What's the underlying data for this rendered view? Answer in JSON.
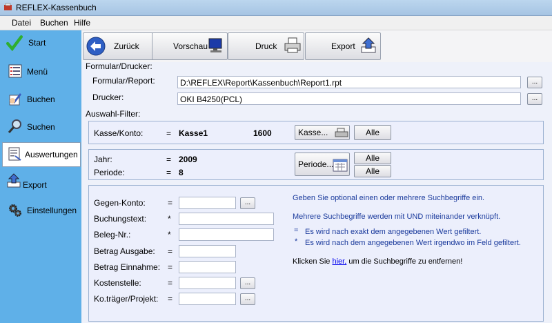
{
  "window": {
    "title": "REFLEX-Kassenbuch"
  },
  "menu": [
    "Datei",
    "Buchen",
    "Hilfe"
  ],
  "sidebar": {
    "items": [
      {
        "label": "Start",
        "icon": "checkmark-icon"
      },
      {
        "label": "Menü",
        "icon": "list-icon"
      },
      {
        "label": "Buchen",
        "icon": "pen-hand-icon"
      },
      {
        "label": "Suchen",
        "icon": "magnifier-icon"
      },
      {
        "label": "Auswertungen",
        "icon": "report-icon",
        "active": true
      },
      {
        "label": "Export",
        "icon": "export-arrow-icon"
      },
      {
        "label": "Einstellungen",
        "icon": "gears-icon"
      }
    ]
  },
  "toolbar": {
    "back": "Zurück",
    "preview": "Vorschau",
    "print": "Druck",
    "export": "Export"
  },
  "printer_section": {
    "title": "Formular/Drucker:",
    "form_label": "Formular/Report:",
    "form_value": "D:\\REFLEX\\Report\\Kassenbuch\\Report1.rpt",
    "printer_label": "Drucker:",
    "printer_value": "OKI B4250(PCL)",
    "browse": "..."
  },
  "filter": {
    "title": "Auswahl-Filter:",
    "kasse_label": "Kasse/Konto:",
    "kasse_op": "=",
    "kasse_value": "Kasse1",
    "kasse_number": "1600",
    "kasse_button": "Kasse...",
    "all": "Alle",
    "jahr_label": "Jahr:",
    "jahr_op": "=",
    "jahr_value": "2009",
    "periode_label": "Periode:",
    "periode_op": "=",
    "periode_value": "8",
    "periode_button": "Periode..."
  },
  "search": {
    "fields": [
      {
        "label": "Gegen-Konto:",
        "op": "="
      },
      {
        "label": "Buchungstext:",
        "op": "*"
      },
      {
        "label": "Beleg-Nr.:",
        "op": "*"
      },
      {
        "label": "Betrag Ausgabe:",
        "op": "="
      },
      {
        "label": "Betrag Einnahme:",
        "op": "="
      },
      {
        "label": "Kostenstelle:",
        "op": "="
      },
      {
        "label": "Ko.träger/Projekt:",
        "op": "="
      }
    ],
    "hint1": "Geben Sie optional einen oder mehrere Suchbegriffe ein.",
    "hint2": "Mehrere Suchbegriffe werden mit UND miteinander verknüpft.",
    "legend_eq_sym": "=",
    "legend_eq": "Es wird nach exakt dem angegebenen Wert gefiltert.",
    "legend_star_sym": "*",
    "legend_star": "Es wird nach dem angegebenen Wert irgendwo im Feld gefiltert.",
    "clear_pre": "Klicken Sie",
    "clear_link": "hier,",
    "clear_post": "um die Suchbegriffe zu entfernen!"
  }
}
